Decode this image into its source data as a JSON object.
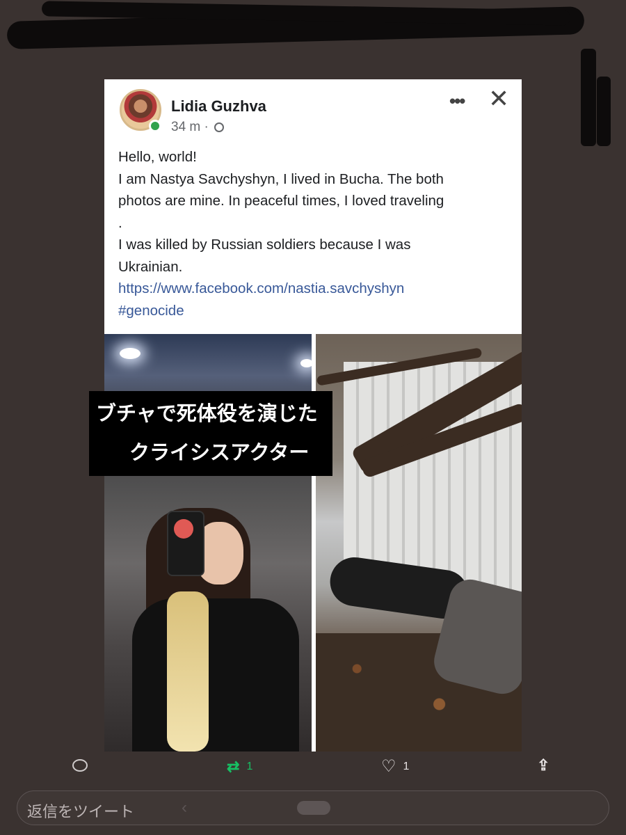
{
  "post": {
    "author": "Lidia Guzhva",
    "time": "34 m ·",
    "lines": [
      "Hello, world!",
      "I am Nastya Savchyshyn, I lived in Bucha. The both",
      "photos are mine. In peaceful times, I loved traveling",
      ".",
      "I was killed by Russian soldiers because I was",
      "Ukrainian."
    ],
    "link": "https://www.facebook.com/nastia.savchyshyn",
    "hashtag": "#genocide"
  },
  "overlay": {
    "line1": "ブチャで死体役を演じた",
    "line2": "クライシスアクター"
  },
  "actions": {
    "retweet_count": "1",
    "like_count": "1",
    "retweet_color": "#17bf63"
  },
  "reply": {
    "placeholder": "返信をツイート"
  },
  "icons": [
    "avatar",
    "online-dot",
    "globe-icon",
    "more-icon",
    "close-icon",
    "reply-icon",
    "retweet-icon",
    "like-icon",
    "share-icon"
  ]
}
